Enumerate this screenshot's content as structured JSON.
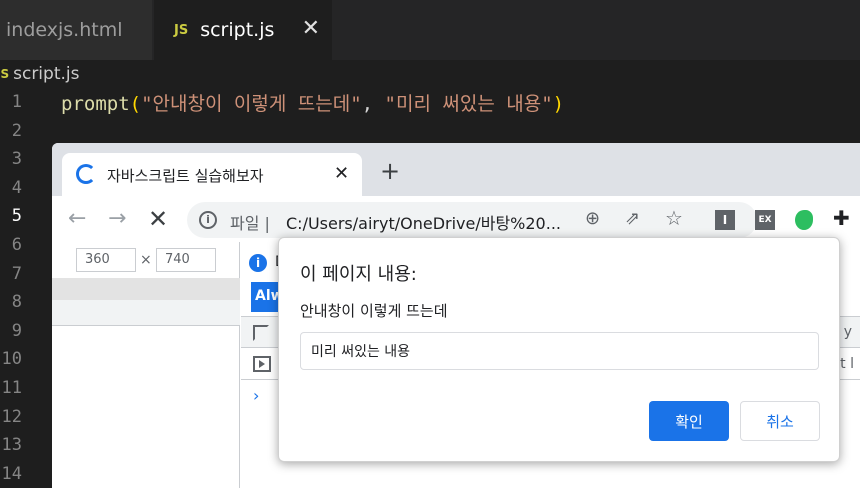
{
  "editor": {
    "tabs": [
      {
        "label": "indexjs.html"
      },
      {
        "label": "script.js",
        "badge": "JS",
        "close": "✕"
      }
    ],
    "breadcrumb": {
      "badge": "JS",
      "label": "script.js"
    },
    "line_numbers": [
      "1",
      "2",
      "3",
      "4",
      "5",
      "6",
      "7",
      "8",
      "9",
      "10",
      "11",
      "12",
      "13",
      "14"
    ],
    "code": {
      "fn": "prompt",
      "open": "(",
      "arg1": "\"안내창이 이렇게 뜨는데\"",
      "comma": ", ",
      "arg2": "\"미리 써있는 내용\"",
      "close": ")"
    }
  },
  "browser": {
    "tab_title": "자바스크립트 실습해보자",
    "tab_close": "✕",
    "new_tab": "+",
    "scheme_label": "파일 |",
    "url": "C:/Users/airyt/OneDrive/바탕%20...",
    "extensions": {
      "reader": "I",
      "ex": "EX"
    },
    "device": {
      "width": "360",
      "times": "×",
      "height": "740"
    },
    "devtools": {
      "info_icon": "i",
      "info_text": "D",
      "always_button": "Alw",
      "right_text_1": "y",
      "right_text_2": "ult l",
      "console_prompt": "›"
    }
  },
  "dialog": {
    "title": "이 페이지 내용:",
    "message": "안내창이 이렇게 뜨는데",
    "input_value": "미리 써있는 내용",
    "ok_label": "확인",
    "cancel_label": "취소"
  },
  "colors": {
    "accent": "#1a73e8",
    "editor_bg": "#1e1e1e",
    "string": "#ce9178",
    "function": "#dcdcaa",
    "bracket": "#ffd700"
  }
}
